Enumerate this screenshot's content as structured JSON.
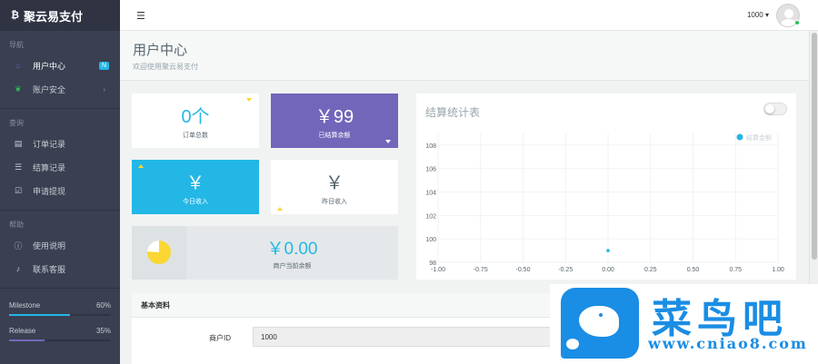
{
  "brand": {
    "icon": "bitcoin-icon",
    "name": "聚云易支付"
  },
  "sidebar": {
    "sections": [
      {
        "heading": "导航",
        "items": [
          {
            "label": "用户中心",
            "icon": "home-icon",
            "badge": "N",
            "active": true
          },
          {
            "label": "账户安全",
            "icon": "leaf-icon",
            "chevron": "›"
          }
        ]
      },
      {
        "heading": "查询",
        "items": [
          {
            "label": "订单记录",
            "icon": "document-icon"
          },
          {
            "label": "结算记录",
            "icon": "list-icon"
          },
          {
            "label": "申请提现",
            "icon": "checkbox-icon"
          }
        ]
      },
      {
        "heading": "帮助",
        "items": [
          {
            "label": "使用说明",
            "icon": "info-icon"
          },
          {
            "label": "联系客服",
            "icon": "bell-icon"
          }
        ]
      }
    ],
    "progress": [
      {
        "label": "Milestone",
        "percent_text": "60%",
        "value": 0.6
      },
      {
        "label": "Release",
        "percent_text": "35%",
        "value": 0.35
      }
    ]
  },
  "header": {
    "menu_icon": "menu-icon",
    "user": "1000",
    "caret": "▾"
  },
  "page": {
    "title": "用户中心",
    "subtitle": "欢迎使用聚云易支付"
  },
  "stats": {
    "orders": {
      "value": "0个",
      "label": "订单总数"
    },
    "settled": {
      "value": "￥99",
      "label": "已结算余额"
    },
    "today": {
      "value": "￥",
      "label": "今日收入"
    },
    "yesterday": {
      "value": "￥",
      "label": "昨日收入"
    },
    "balance": {
      "value": "￥0.00",
      "label": "商户当前余额"
    }
  },
  "chart_data": {
    "type": "scatter",
    "title": "结算统计表",
    "series": [
      {
        "name": "结算金额",
        "color": "#23b7e5",
        "points": [
          [
            0.0,
            99
          ]
        ]
      }
    ],
    "x_ticks": [
      "-1.00",
      "-0.75",
      "-0.50",
      "-0.25",
      "0.00",
      "0.25",
      "0.50",
      "0.75",
      "1.00"
    ],
    "y_ticks": [
      "98",
      "100",
      "102",
      "104",
      "106",
      "108"
    ],
    "xlim": [
      -1,
      1
    ],
    "ylim": [
      98,
      109
    ],
    "grid": true,
    "legend_position": "top-right"
  },
  "info": {
    "heading": "基本资料",
    "fields": [
      {
        "label": "商户ID",
        "value": "1000"
      }
    ]
  },
  "watermark": {
    "title": "菜鸟吧",
    "url": "www.cniao8.com"
  },
  "colors": {
    "sidebar": "#3a3f51",
    "accent_blue": "#23b7e5",
    "purple": "#7266ba",
    "yellow": "#fad733"
  }
}
